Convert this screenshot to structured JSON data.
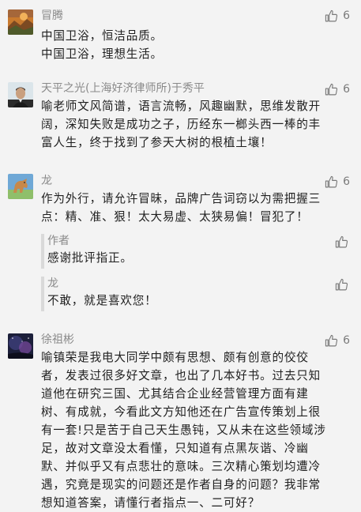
{
  "comments": [
    {
      "name": "冒腾",
      "likes": "6",
      "lines": [
        "中国卫浴，恒洁品质。",
        "中国卫浴，理想生活。"
      ],
      "avatar_icon": "orange-landscape-avatar-icon"
    },
    {
      "name": "天平之光(上海好济律师所)于秀平",
      "likes": "6",
      "lines": [
        "喻老师文风简谱，语言流畅，风趣幽默，思维发散开",
        "阔，深知失败是成功之子，历经东一榔头西一棒的丰",
        "富人生，终于找到了参天大树的根植土壤！"
      ],
      "avatar_icon": "man-portrait-avatar-icon"
    },
    {
      "name": "龙",
      "likes": "6",
      "lines": [
        "作为外行，请允许冒昧，品牌广告词窃以为需把握三",
        "点：精、准、狠！太大易虚、太狭易偏！冒犯了！"
      ],
      "avatar_icon": "horse-avatar-icon",
      "replies": [
        {
          "name": "作者",
          "text": "感谢批评指正。"
        },
        {
          "name": "龙",
          "text": "不敢，就是喜欢您！"
        }
      ]
    },
    {
      "name": "徐祖彬",
      "likes": "6",
      "lines": [
        "喻镇荣是我电大同学中颇有思想、颇有创意的佼佼",
        "者，发表过很多好文章，也出了几本好书。过去只知",
        "道他在研究三国、尤其结合企业经营管理方面有建",
        "树、有成就，今看此文方知他还在广告宣传策划上很",
        "有一套!只是苦于自己天生愚钝，又从未在这些领域涉",
        "足，故对文章没太看懂，只知道有点黑灰谐、冷幽",
        "默、并似乎又有点悲壮的意味。三次精心策划均遭冷",
        "遇，究竟是现实的问题还是作者自身的问题？我非常",
        "想知道答案，请懂行者指点一、二可好？"
      ],
      "avatar_icon": "night-sky-avatar-icon"
    }
  ],
  "icons": {
    "like": "thumbs-up-icon",
    "like_color": "#7a7a7a"
  }
}
